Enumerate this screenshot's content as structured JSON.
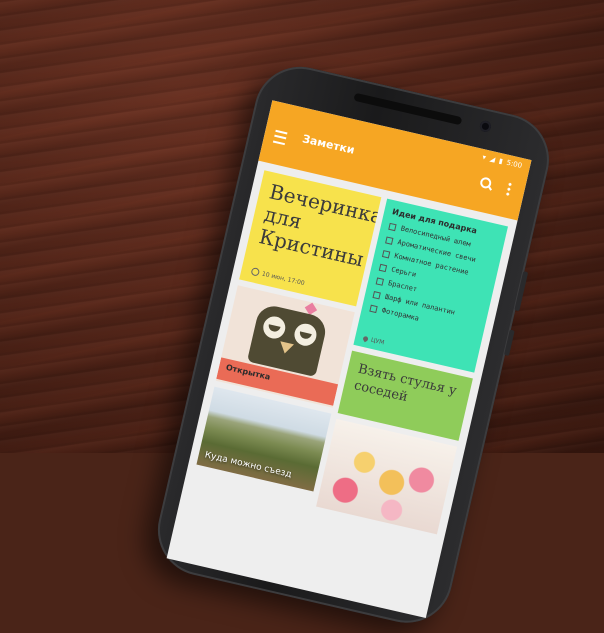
{
  "app": {
    "title": "Заметки",
    "status_time": "5:00",
    "accent_color": "#f6a623"
  },
  "notes": {
    "party": {
      "title": "Вечеринка для Кристины",
      "reminder": "10 июн, 17:00"
    },
    "gifts": {
      "title": "Идеи для подарка",
      "items": [
        "Велосипедный шлем",
        "Ароматические свечи",
        "Комнатное растение",
        "Серьги",
        "Браслет",
        "Шарф или палантин",
        "Фоторамка"
      ],
      "location": "ЦУМ"
    },
    "card": {
      "title": "Открытка"
    },
    "chairs": {
      "title": "Взять стулья у соседей"
    },
    "trip": {
      "caption": "Куда можно съезд"
    }
  },
  "icons": {
    "menu": "menu-icon",
    "search": "search-icon",
    "more": "more-vert-icon",
    "clock": "clock-icon",
    "pin": "location-pin-icon"
  }
}
